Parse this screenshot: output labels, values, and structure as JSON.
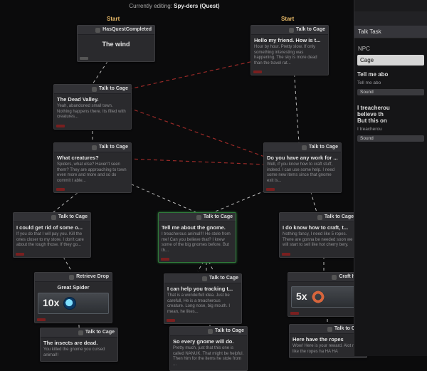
{
  "header": {
    "prefix": "Currently editing:",
    "title": "Spy-ders (Quest)"
  },
  "start_labels": [
    "Start",
    "Start"
  ],
  "nodes": {
    "n1": {
      "header": "HasQuestCompleted",
      "title": "The wind",
      "desc": ""
    },
    "n2": {
      "header": "Talk to Cage",
      "title": "Hello my friend. How is t...",
      "desc": "Hour by hour. Pretty slow. If only something interesting was happening. The sky is more dead than the travel rat..."
    },
    "n3": {
      "header": "Talk to Cage",
      "title": "The Dead Valley.",
      "desc": "Yeah, abandoned small town. Nothing happens there. Its filled with creatures..."
    },
    "n4": {
      "header": "Talk to Cage",
      "title": "What creatures?",
      "desc": "Spiders, what else? Haven't seen them? They are approaching to town even more and more and so do commit t able..."
    },
    "n5": {
      "header": "Talk to Cage",
      "title": "Do you have any work for ...",
      "desc": "Well, if you know how to craft stuff, indeed. I can use some help. I need some new items since that gnome exit is..."
    },
    "n6": {
      "header": "Talk to Cage",
      "title": "I could get rid of some o...",
      "desc": "If you do that I will pay you. Kill the ones closer to my store. I don't care about the tough those. If they go..."
    },
    "n7": {
      "header": "Talk to Cage",
      "title": "Tell me about the gnome.",
      "desc": "I treacherous animal!!! He stole from me! Can you believe that? I knew some of the big gnomes before. But th..."
    },
    "n8": {
      "header": "Talk to Cage",
      "title": "I do know how to craft, t...",
      "desc": "Nothing fancy, I need like 5 ropes. There are gonna be needed soon we will start to sell like hot cherry bery."
    },
    "n9": {
      "header": "Retrieve Drop",
      "title": "Great Spider",
      "desc": "",
      "objective": {
        "count": "10x",
        "icon": "eye"
      }
    },
    "n10": {
      "header": "Talk to Cage",
      "title": "I can help you tracking t...",
      "desc": "That is a wonderfull idea. Just be carefull, He is a treacherous creature. Long nose, big mouth. I mean, he likes..."
    },
    "n11": {
      "header": "Craft Item",
      "title": "",
      "desc": "",
      "objective": {
        "count": "5x",
        "icon": "ring"
      }
    },
    "n12": {
      "header": "Talk to Cage",
      "title": "The insects are dead.",
      "desc": "You killed the gnome you cursed animal!!"
    },
    "n13": {
      "header": "Talk to Cage",
      "title": "So every gnome will do.",
      "desc": "Pretty much, just that this one is called NANUK. That might be helpful. Then him for the items he stole from ..."
    },
    "n14": {
      "header": "Talk to Cage",
      "title": "Here have the ropes",
      "desc": "Wow! Here is your reward. Alot right, like the ropes ha HA HA"
    }
  },
  "sidepanel": {
    "task_header": "Talk Task ",
    "npc_label": "NPC",
    "npc_value": "Cage",
    "line_title": "Tell me abo",
    "line_sub": "Tell me abo",
    "sound1": "Sound",
    "reply_title": "I treacherou",
    "reply_sub1": "believe th",
    "reply_sub2": "But this on",
    "reply_small": "I treacherou",
    "sound2": "Sound"
  }
}
